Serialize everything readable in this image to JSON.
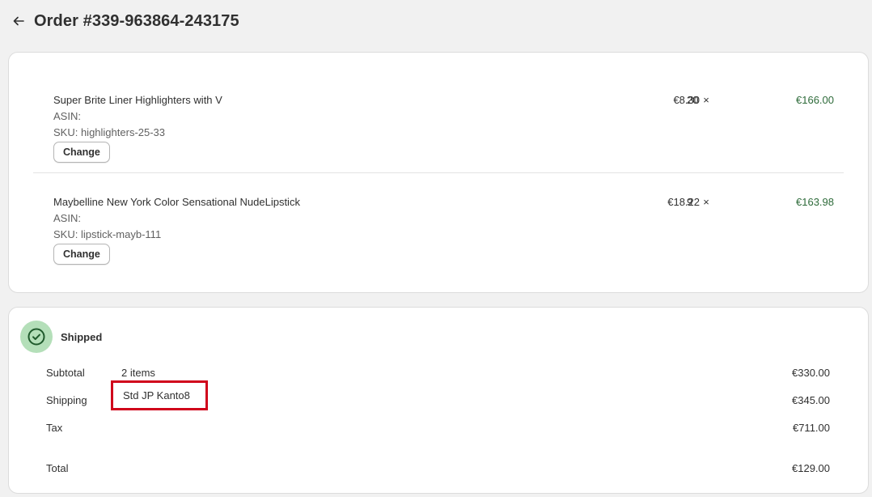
{
  "header": {
    "back_icon": "arrow-left-icon",
    "title": "Order #339-963864-243175"
  },
  "items": [
    {
      "name": "Super Brite Liner Highlighters with V",
      "asin": "ASIN:",
      "sku": "SKU: highlighters-25-33",
      "change_label": "Change",
      "price": "€8.30",
      "times": "×",
      "qty": "20",
      "total": "€166.00"
    },
    {
      "name": "Maybelline New York Color Sensational NudeLipstick",
      "asin": "ASIN:",
      "sku": "SKU: lipstick-mayb-111",
      "change_label": "Change",
      "price": "€18.22",
      "times": "×",
      "qty": "9",
      "total": "€163.98"
    }
  ],
  "fulfillment": {
    "status_icon": "check-circle-icon",
    "status": "Shipped"
  },
  "summary": {
    "subtotal": {
      "label": "Subtotal",
      "desc": "2 items",
      "amount": "€330.00"
    },
    "shipping": {
      "label": "Shipping",
      "desc": "Std JP Kanto8",
      "amount": "€345.00"
    },
    "tax": {
      "label": "Tax",
      "desc": "",
      "amount": "€711.00"
    },
    "total": {
      "label": "Total",
      "desc": "",
      "amount": "€129.00"
    }
  },
  "colors": {
    "accent_green": "#2e6b3a",
    "status_bg": "#b4dfb9",
    "highlight_border": "#d0021b"
  }
}
